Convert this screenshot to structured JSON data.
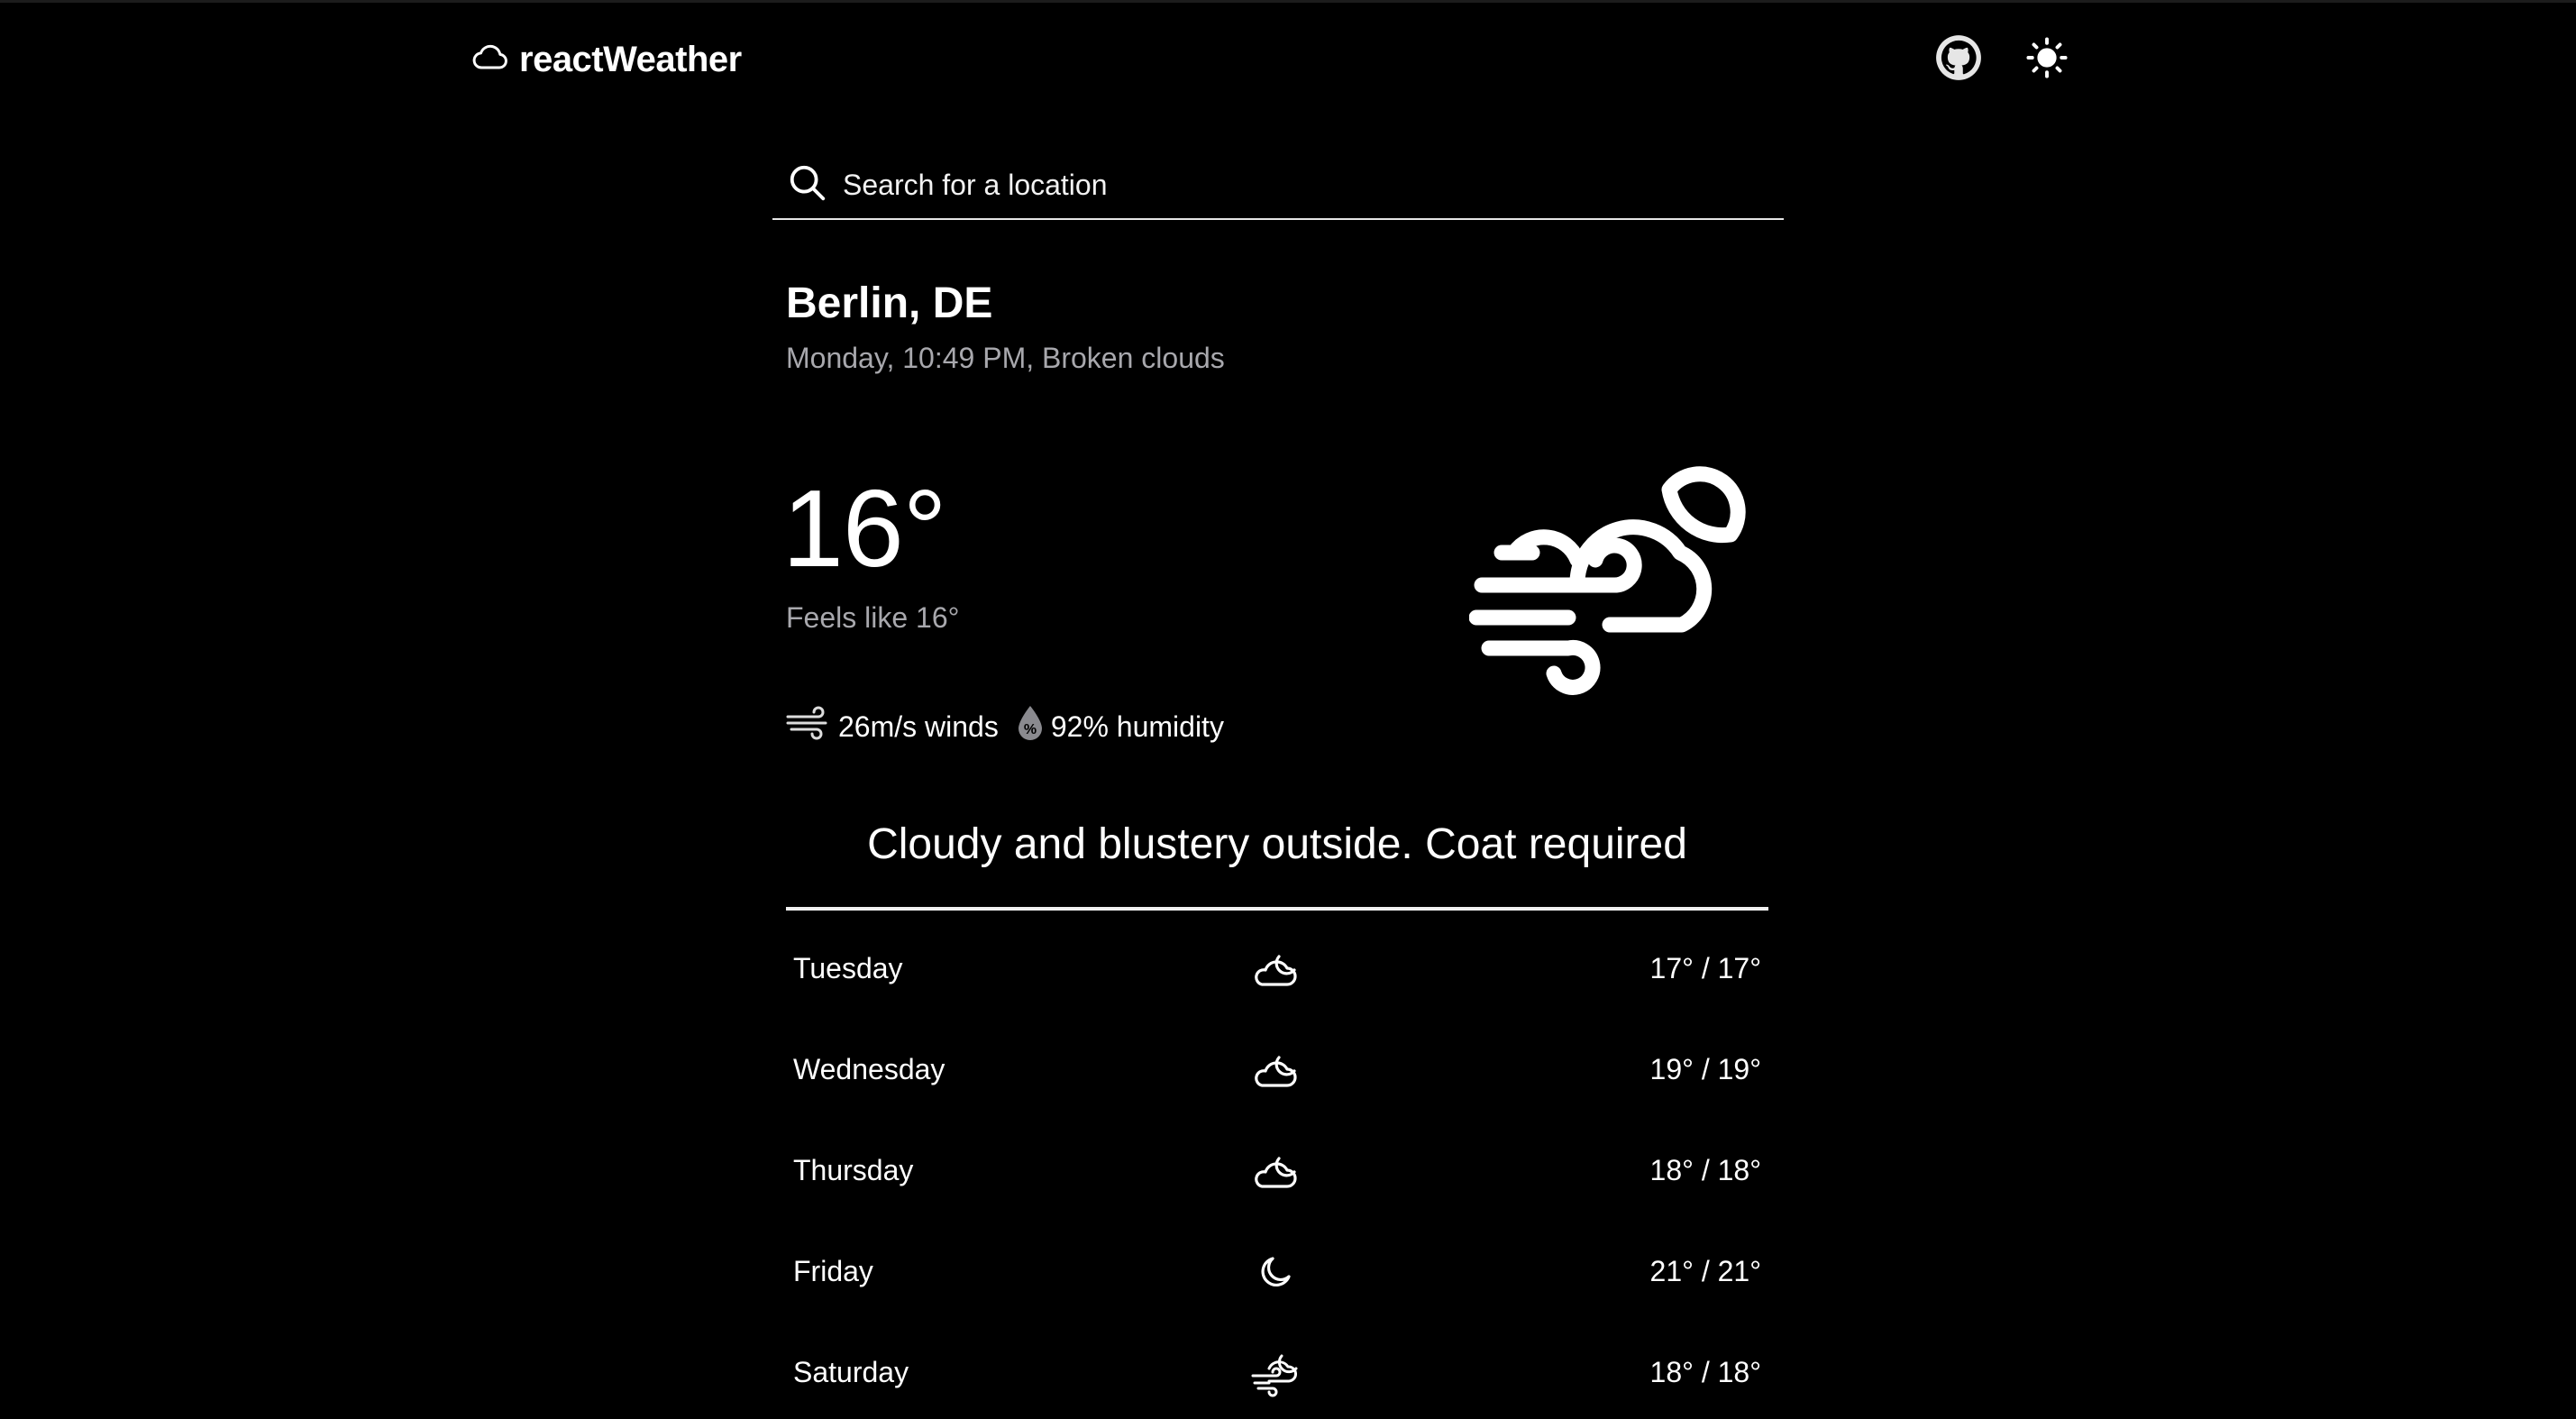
{
  "header": {
    "brand_name": "reactWeather",
    "brand_icon": "cloud-icon",
    "github_icon": "github-icon",
    "theme_icon": "sun-icon"
  },
  "search": {
    "placeholder": "Search for a location",
    "value": "",
    "icon": "search-icon"
  },
  "current": {
    "location": "Berlin, DE",
    "subtitle": "Monday, 10:49 PM, Broken clouds",
    "temperature": "16°",
    "feels_like": "Feels like 16°",
    "icon": "cloudy-windy-night-icon",
    "wind_text": "26m/s winds",
    "humidity_text": "92% humidity",
    "summary": "Cloudy and blustery outside. Coat required"
  },
  "forecast": [
    {
      "day": "Tuesday",
      "icon": "cloud-moon-icon",
      "range": "17° / 17°"
    },
    {
      "day": "Wednesday",
      "icon": "cloud-moon-icon",
      "range": "19° / 19°"
    },
    {
      "day": "Thursday",
      "icon": "cloud-moon-icon",
      "range": "18° / 18°"
    },
    {
      "day": "Friday",
      "icon": "moon-icon",
      "range": "21° / 21°"
    },
    {
      "day": "Saturday",
      "icon": "cloud-wind-moon-icon",
      "range": "18° / 18°"
    }
  ],
  "colors": {
    "background": "#000000",
    "text": "#ffffff",
    "muted": "#a8a8ad"
  }
}
